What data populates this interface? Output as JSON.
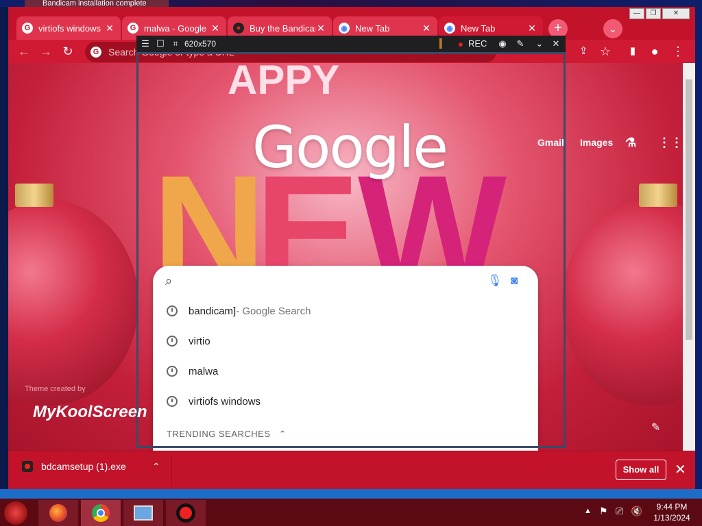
{
  "background_window": {
    "tab_title": "Bandicam installation complete"
  },
  "chrome": {
    "tabs": [
      {
        "title": "virtiofs windows",
        "favicon": "google-icon"
      },
      {
        "title": "malwa - Google",
        "favicon": "google-icon"
      },
      {
        "title": "Buy the Bandicam",
        "favicon": "bandicam-icon"
      },
      {
        "title": "New Tab",
        "favicon": "chrome-icon"
      },
      {
        "title": "New Tab",
        "favicon": "chrome-icon",
        "active": true
      }
    ],
    "omnibox": {
      "placeholder": "Search Google or type a URL"
    }
  },
  "bandicam": {
    "size": "620x570",
    "rec_label": "REC"
  },
  "google": {
    "logo": "Google",
    "links": {
      "gmail": "Gmail",
      "images": "Images"
    },
    "suggestions": [
      {
        "text": "bandicam]",
        "suffix": " - Google Search"
      },
      {
        "text": "virtio",
        "suffix": ""
      },
      {
        "text": "malwa",
        "suffix": ""
      },
      {
        "text": "virtiofs windows",
        "suffix": ""
      }
    ],
    "trending_label": "TRENDING SEARCHES"
  },
  "background_art": {
    "letters": "NEW"
  },
  "watermark": {
    "small": "Theme created by",
    "big": "MyKoolScreen"
  },
  "download_bar": {
    "filename": "bdcamsetup (1).exe",
    "show_all": "Show all"
  },
  "taskbar": {
    "time": "9:44 PM",
    "date": "1/13/2024"
  },
  "colors": {
    "chrome_frame": "#c3132a",
    "rec_dot": "#e02020",
    "taskbar": "#5b0a14"
  }
}
